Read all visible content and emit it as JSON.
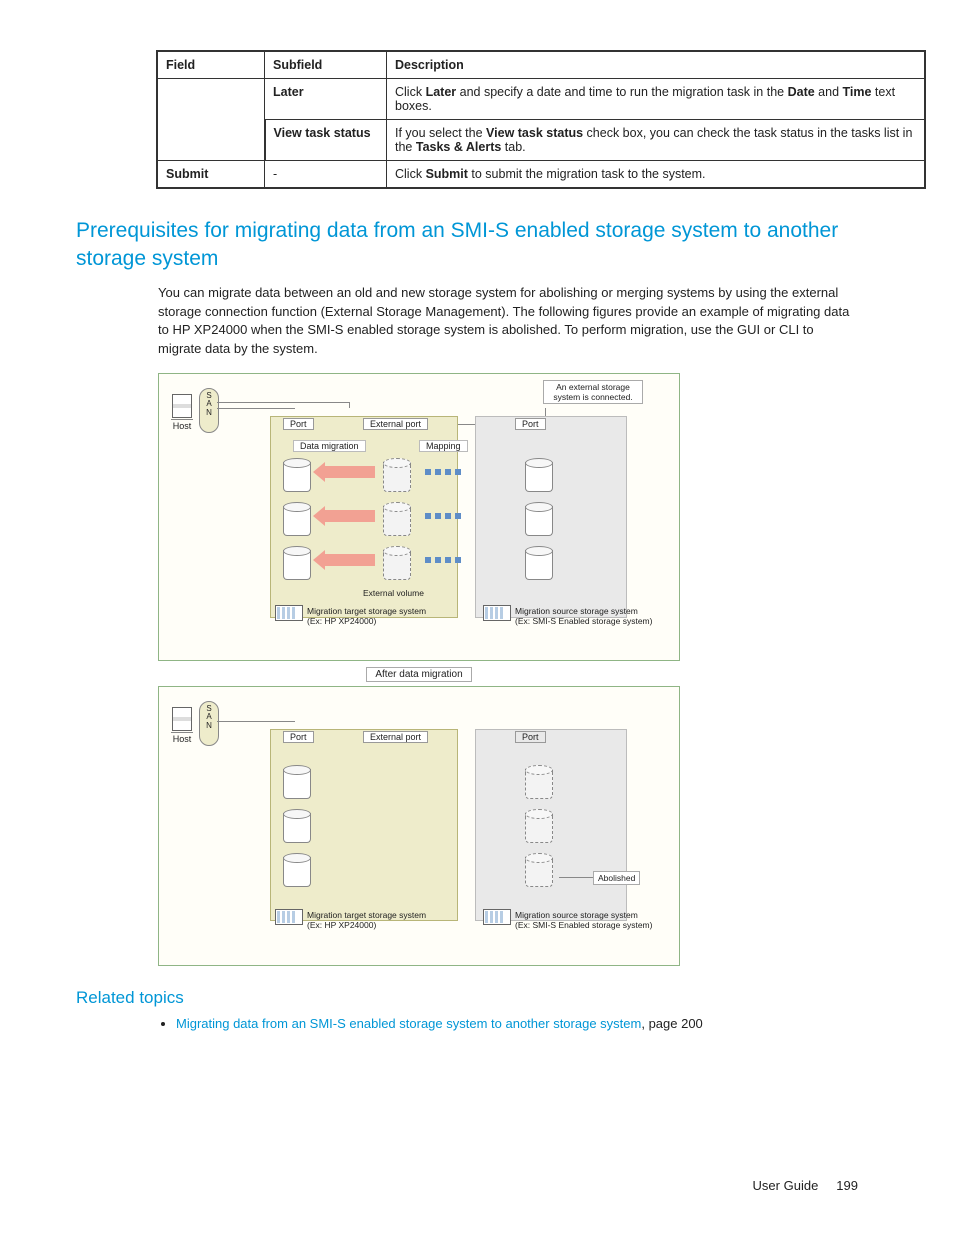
{
  "table": {
    "headers": [
      "Field",
      "Subfield",
      "Description"
    ],
    "rows": [
      {
        "field": "",
        "subfield": "Later",
        "desc_parts": [
          "Click ",
          "Later",
          " and specify a date and time to run the migration task in the ",
          "Date",
          " and ",
          "Time",
          " text boxes."
        ]
      },
      {
        "field": "",
        "subfield": "View task status",
        "desc_parts": [
          "If you select the ",
          "View task status",
          " check box, you can check the task status in the tasks list in the ",
          "Tasks & Alerts",
          " tab."
        ]
      },
      {
        "field": "Submit",
        "subfield": "-",
        "desc_parts": [
          "Click ",
          "Submit",
          " to submit the migration task to the system."
        ]
      }
    ]
  },
  "section_title": "Prerequisites for migrating data from an SMI-S enabled storage system to another storage system",
  "section_para": "You can migrate data between an old and new storage system for abolishing or merging systems by using the external storage connection function (External Storage Management). The following figures provide an example of migrating data to HP XP24000 when the SMI-S enabled storage system is abolished. To perform migration, use the GUI or CLI to migrate data by the system.",
  "diagram": {
    "host": "Host",
    "san": "S\nA\nN",
    "port": "Port",
    "external_port": "External port",
    "data_migration": "Data migration",
    "mapping": "Mapping",
    "external_volume": "External volume",
    "note_connected": "An external storage system is connected.",
    "after_label": "After data migration",
    "abolished": "Abolished",
    "target_caption": "Migration target storage system\n(Ex: HP XP24000)",
    "source_caption": "Migration source storage system\n(Ex: SMI-S Enabled storage system)"
  },
  "related": {
    "heading": "Related topics",
    "items": [
      {
        "link": "Migrating data from an SMI-S enabled storage system to another storage system",
        "page_suffix": ", page 200"
      }
    ]
  },
  "footer": {
    "label": "User Guide",
    "page": "199"
  }
}
